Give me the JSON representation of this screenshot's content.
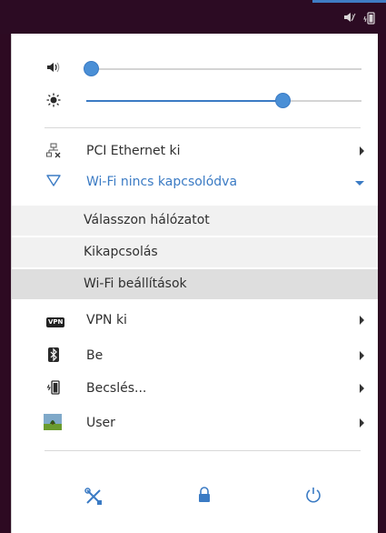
{
  "topbar": {
    "tray_icons": [
      "speaker-muted-icon",
      "battery-charging-icon"
    ]
  },
  "sliders": {
    "volume": {
      "icon": "speaker-icon",
      "level": 0.0
    },
    "brightness": {
      "icon": "brightness-icon",
      "level": 0.73
    }
  },
  "network": {
    "ethernet_label": "PCI Ethernet ki",
    "wifi_label": "Wi-Fi nincs kapcsolódva",
    "wifi_submenu": {
      "select_network": "Válasszon hálózatot",
      "turn_off": "Kikapcsolás",
      "settings": "Wi-Fi beállítások"
    },
    "vpn_label": "VPN ki",
    "vpn_icon_text": "VPN",
    "bluetooth_label": "Be",
    "battery_label": "Becslés..."
  },
  "user": {
    "label": "User"
  },
  "colors": {
    "accent": "#3b7bc4",
    "topbar": "#2c0b23",
    "hover": "#dedede",
    "submenu": "#f1f1f1"
  },
  "bottom_buttons": [
    "settings-icon",
    "lock-icon",
    "power-icon"
  ]
}
